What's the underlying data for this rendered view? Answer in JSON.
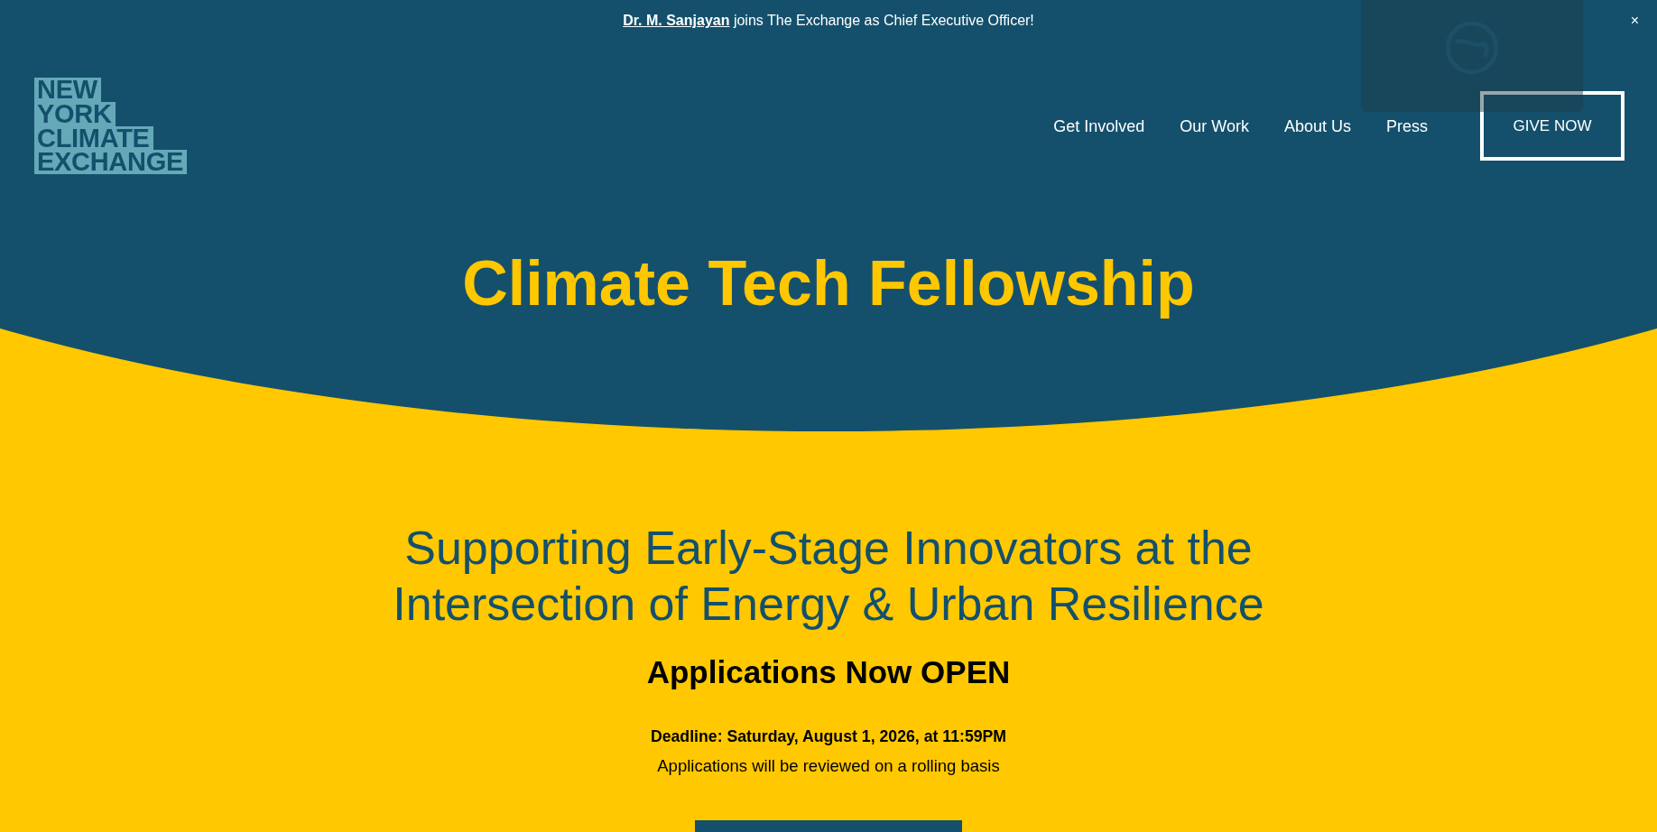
{
  "announcement": {
    "link": "Dr. M. Sanjayan",
    "text": " joins The Exchange as Chief Executive Officer!",
    "close": "×"
  },
  "logo": {
    "lines": [
      "NEW",
      "YORK",
      "CLIMATE",
      "EXCHANGE"
    ]
  },
  "nav": [
    {
      "label": "Get Involved"
    },
    {
      "label": "Our Work"
    },
    {
      "label": "About Us"
    },
    {
      "label": "Press"
    }
  ],
  "cta": {
    "label": "GIVE NOW"
  },
  "hero": {
    "title": "Climate Tech Fellowship"
  },
  "intro": {
    "subtitle": "Supporting Early-Stage Innovators at the Intersection of Energy & Urban Resilience",
    "status": "Applications Now OPEN",
    "deadline": "Deadline: Saturday, August 1, 2026, at 11:59PM",
    "note": "Applications will be reviewed on a rolling basis"
  }
}
